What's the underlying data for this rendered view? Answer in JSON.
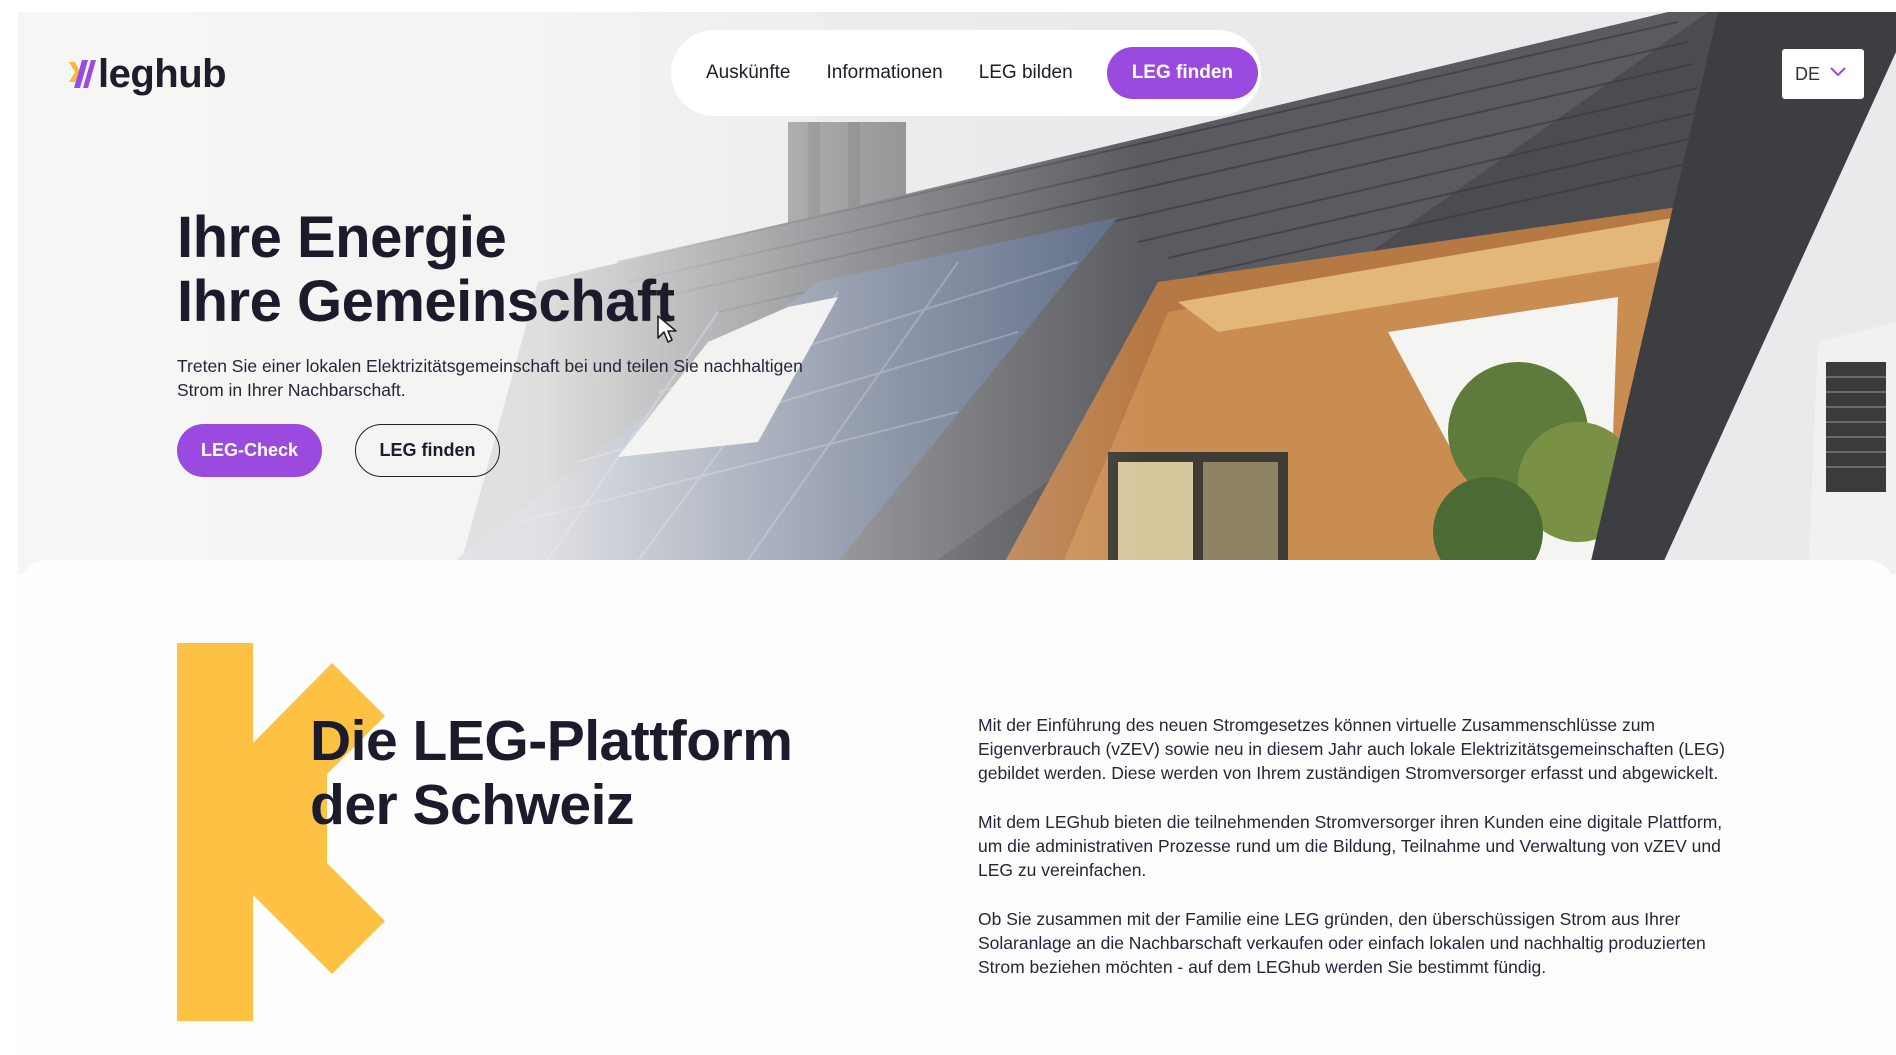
{
  "brand": {
    "logo_text": "leghub",
    "accent_color": "#9b4ae0",
    "logo_mark_color": "#f6b93b"
  },
  "nav": {
    "links": [
      "Auskünfte",
      "Informationen",
      "LEG bilden"
    ],
    "cta_label": "LEG finden"
  },
  "language": {
    "selected": "DE",
    "icon": "chevron-down-icon"
  },
  "hero": {
    "title_line1": "Ihre Energie",
    "title_line2": "Ihre Gemeinschaft",
    "subtitle_line1": "Treten Sie einer lokalen Elektrizitätsgemeinschaft bei und teilen Sie nachhaltigen",
    "subtitle_line2": "Strom in Ihrer Nachbarschaft.",
    "primary_button": "LEG-Check",
    "secondary_button": "LEG finden"
  },
  "platform": {
    "title_line1": "Die LEG-Plattform",
    "title_line2": "der Schweiz",
    "k_shape_color": "#fdc243",
    "paragraphs": [
      [
        "Mit der Einführung des neuen Stromgesetzes können virtuelle Zusammenschlüsse zum",
        "Eigenverbrauch (vZEV) sowie neu in diesem Jahr auch lokale Elektrizitätsgemeinschaften (LEG)",
        "gebildet werden. Diese werden von Ihrem zuständigen Stromversorger erfasst und abgewickelt."
      ],
      [
        "Mit dem LEGhub bieten die teilnehmenden Stromversorger ihren Kunden eine digitale Plattform,",
        "um die administrativen Prozesse rund um die Bildung, Teilnahme und Verwaltung von vZEV und",
        "LEG zu vereinfachen."
      ],
      [
        "Ob Sie zusammen mit der Familie eine LEG gründen, den überschüssigen Strom aus Ihrer",
        "Solaranlage an die Nachbarschaft verkaufen oder einfach lokalen und nachhaltig produzierten",
        "Strom beziehen möchten - auf dem LEGhub werden Sie bestimmt fündig."
      ]
    ]
  }
}
